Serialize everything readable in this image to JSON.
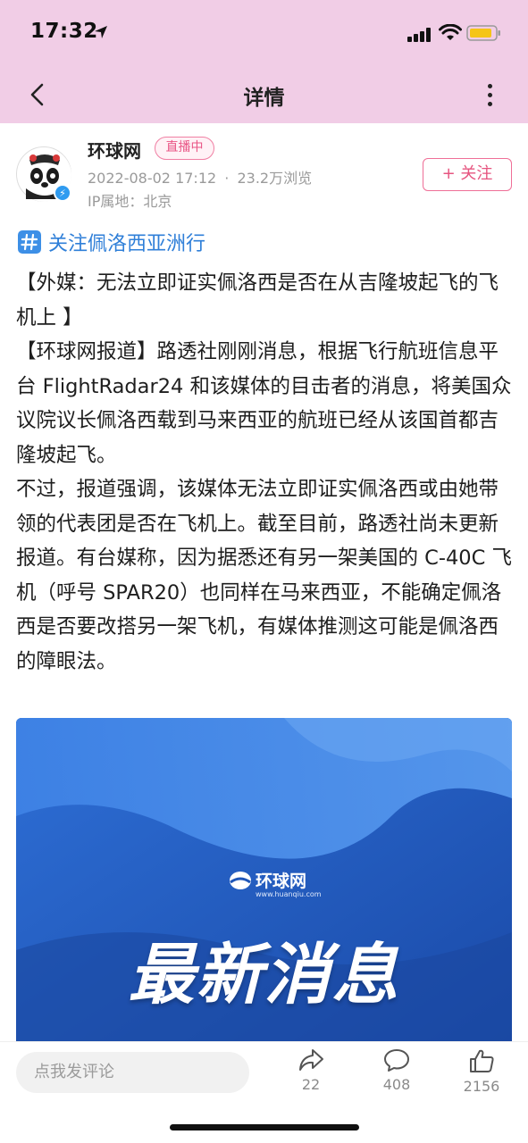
{
  "status_bar": {
    "time": "17:32"
  },
  "nav": {
    "title": "详情"
  },
  "author": {
    "name": "环球网",
    "live_label": "直播中",
    "datetime": "2022-08-02 17:12",
    "separator": "·",
    "views": "23.2万浏览",
    "ip": "IP属地：北京",
    "follow_label": "+ 关注"
  },
  "topic": {
    "label": "关注佩洛西亚洲行"
  },
  "article": {
    "paragraphs": [
      "【外媒：无法立即证实佩洛西是否在从吉隆坡起飞的飞机上 】",
      "【环球网报道】路透社刚刚消息，根据飞行航班信息平台 FlightRadar24 和该媒体的目击者的消息，将美国众议院议长佩洛西载到马来西亚的航班已经从该国首都吉隆坡起飞。",
      "不过，报道强调，该媒体无法立即证实佩洛西或由她带领的代表团是否在飞机上。截至目前，路透社尚未更新报道。有台媒称，因为据悉还有另一架美国的 C-40C 飞机（呼号 SPAR20）也同样在马来西亚，不能确定佩洛西是否要改搭另一架飞机，有媒体推测这可能是佩洛西的障眼法。"
    ]
  },
  "banner": {
    "logo_text": "环球网",
    "logo_url": "www.huanqiu.com",
    "headline": "最新消息"
  },
  "bottom_bar": {
    "comment_placeholder": "点我发评论",
    "share_count": "22",
    "comment_count": "408",
    "like_count": "2156"
  }
}
